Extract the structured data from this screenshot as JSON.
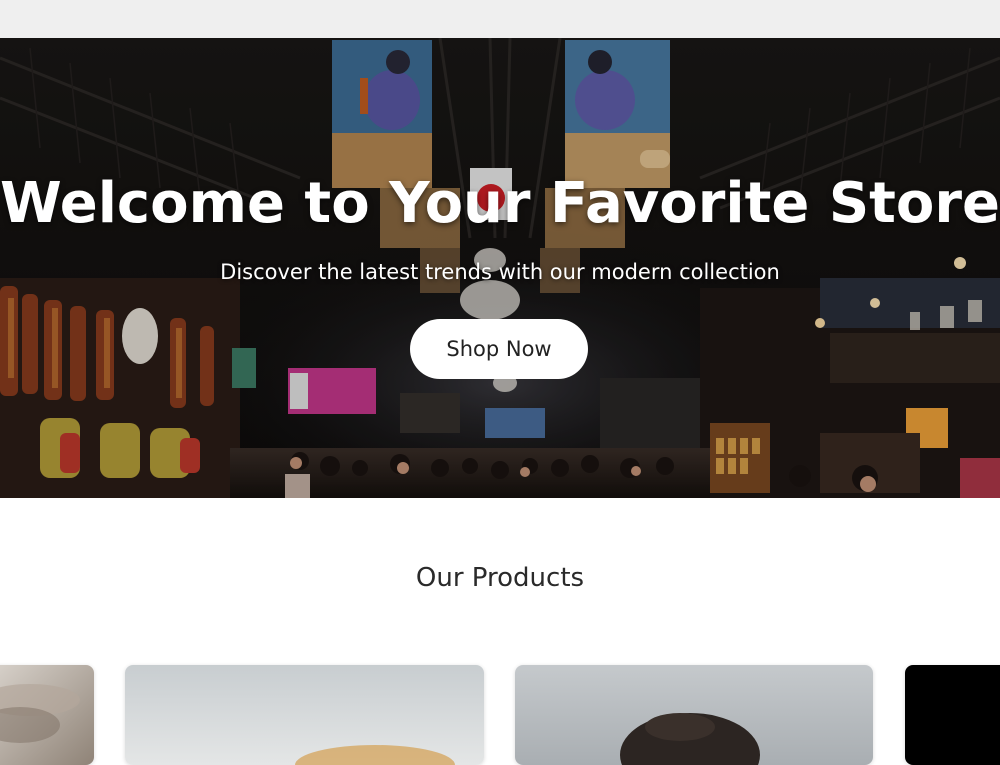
{
  "hero": {
    "title": "Welcome to Your Favorite Store",
    "subtitle": "Discover the latest trends with our modern collection",
    "cta_label": "Shop Now",
    "background_image": "indoor-market-hall-photo"
  },
  "products": {
    "heading": "Our Products",
    "cards": [
      {
        "image": "product-photo-partial-left"
      },
      {
        "image": "product-photo-bread"
      },
      {
        "image": "product-photo-person-hair"
      },
      {
        "image": "product-photo-dark"
      }
    ]
  },
  "colors": {
    "topbar": "#efefef",
    "page_background": "#ffffff",
    "hero_text": "#ffffff",
    "button_background": "#ffffff",
    "button_text": "#222222",
    "heading_text": "#2a2a2a"
  }
}
